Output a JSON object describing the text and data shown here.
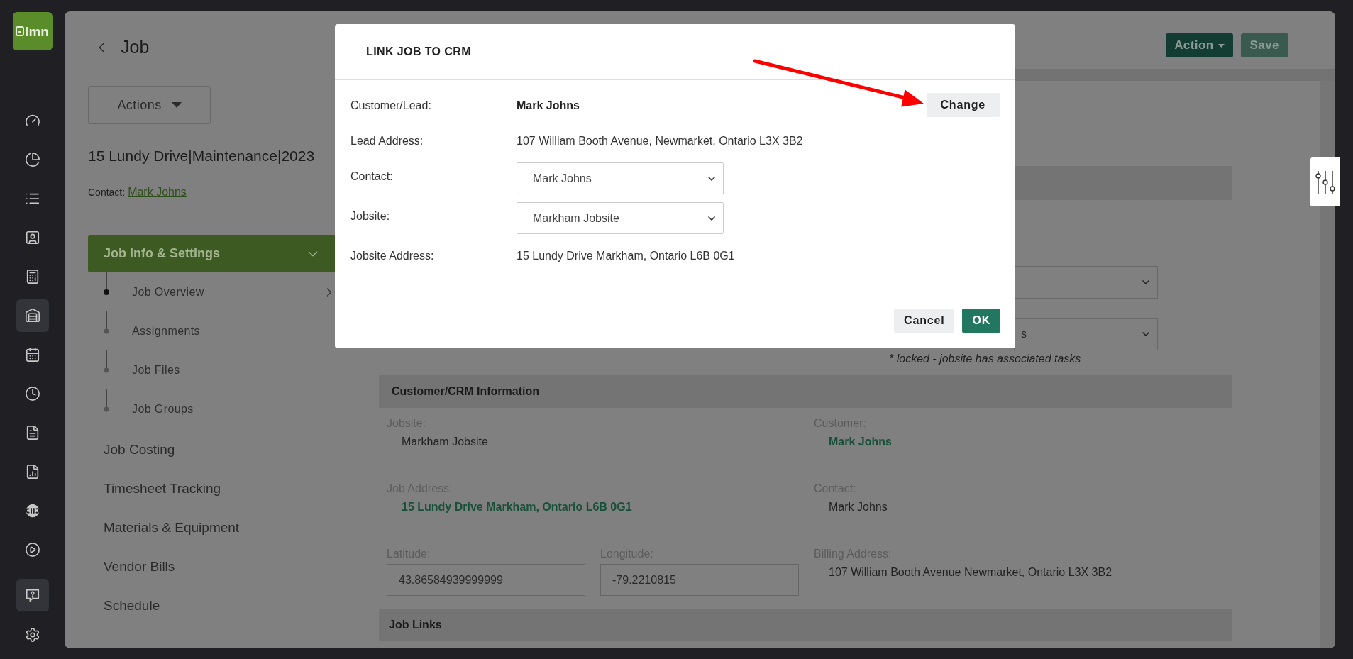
{
  "rail": {
    "logo": "lmn",
    "items": [
      {
        "kind": "gauge",
        "selected": false
      },
      {
        "kind": "pie",
        "selected": false
      },
      {
        "kind": "list",
        "selected": false
      },
      {
        "kind": "contact",
        "selected": false
      },
      {
        "kind": "calculator",
        "selected": false
      },
      {
        "kind": "warehouse",
        "selected": true
      },
      {
        "kind": "calendar",
        "selected": false
      },
      {
        "kind": "clock",
        "selected": false
      },
      {
        "kind": "invoice",
        "selected": false
      },
      {
        "kind": "report",
        "selected": false
      },
      {
        "kind": "accounting",
        "selected": false
      },
      {
        "kind": "play",
        "selected": false
      }
    ],
    "bottom_items": [
      {
        "kind": "help",
        "selected": true
      },
      {
        "kind": "settings",
        "selected": false
      }
    ]
  },
  "page": {
    "title": "Job",
    "actions_button": "Actions",
    "job_title": "15 Lundy Drive|Maintenance|2023",
    "contact_label": "Contact:",
    "contact_name": "Mark Johns"
  },
  "nav": {
    "section": {
      "label": "Job Info & Settings",
      "expanded": true
    },
    "sub_items": [
      {
        "label": "Job Overview",
        "selected": true
      },
      {
        "label": "Assignments",
        "selected": false
      },
      {
        "label": "Job Files",
        "selected": false
      },
      {
        "label": "Job Groups",
        "selected": false
      }
    ],
    "items": [
      "Job Costing",
      "Timesheet Tracking",
      "Materials & Equipment",
      "Vendor Bills",
      "Schedule"
    ]
  },
  "toolbar": {
    "action_button": "Action",
    "save_button": {
      "label": "Save",
      "disabled": true
    }
  },
  "settings_form": {
    "selects": [
      {
        "kind": "blank"
      },
      {
        "kind": "text",
        "value": "s"
      }
    ],
    "locked_note": "* locked - jobsite has associated tasks"
  },
  "crm_section": {
    "title": "Customer/CRM Information",
    "rows": [
      [
        {
          "kind": "text",
          "label": "Jobsite:",
          "value": "Markham Jobsite"
        },
        {
          "kind": "link",
          "label": "Customer:",
          "value": "Mark Johns"
        }
      ],
      [
        {
          "kind": "link",
          "label": "Job Address:",
          "value": "15 Lundy Drive Markham, Ontario L6B 0G1"
        },
        {
          "kind": "text",
          "label": "Contact:",
          "value": "Mark Johns"
        }
      ],
      [
        {
          "kind": "input",
          "label": "Latitude:",
          "value": "43.86584939999999"
        },
        {
          "kind": "input",
          "label": "Longitude:",
          "value": "-79.2210815"
        },
        {
          "kind": "text",
          "label": "Billing Address:",
          "value": "107 William Booth Avenue Newmarket, Ontario L3X 3B2"
        }
      ]
    ]
  },
  "job_links": {
    "title": "Job Links"
  },
  "dialog": {
    "title": "LINK JOB TO CRM",
    "change_button": "Change",
    "rows": [
      {
        "kind": "strong",
        "label": "Customer/Lead:",
        "value": "Mark Johns"
      },
      {
        "kind": "text",
        "label": "Lead Address:",
        "value": "107 William Booth Avenue, Newmarket, Ontario L3X 3B2"
      },
      {
        "kind": "select",
        "label": "Contact:",
        "value": "Mark Johns"
      },
      {
        "kind": "select",
        "label": "Jobsite:",
        "value": "Markham Jobsite"
      },
      {
        "kind": "text",
        "label": "Jobsite Address:",
        "value": "15 Lundy Drive Markham, Ontario L6B 0G1"
      }
    ],
    "buttons": [
      {
        "kind": "secondary",
        "label": "Cancel"
      },
      {
        "kind": "primary",
        "label": "OK"
      }
    ]
  }
}
